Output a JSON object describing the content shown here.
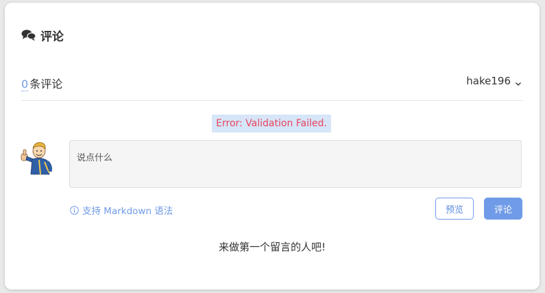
{
  "header": {
    "title": "评论",
    "icon": "comments-icon"
  },
  "count": {
    "value": "0",
    "label": "条评论"
  },
  "user": {
    "name": "hake196",
    "icon": "chevron-down-icon"
  },
  "error": {
    "message": "Error: Validation Failed."
  },
  "editor": {
    "placeholder": "说点什么",
    "value": ""
  },
  "markdown_hint": {
    "label": "支持 Markdown 语法",
    "icon": "info-icon"
  },
  "buttons": {
    "preview_label": "预览",
    "submit_label": "评论"
  },
  "empty": {
    "message": "来做第一个留言的人吧!"
  },
  "colors": {
    "accent": "#6f9be8",
    "error": "#e9435f",
    "error_bg": "#d6e5f7"
  }
}
